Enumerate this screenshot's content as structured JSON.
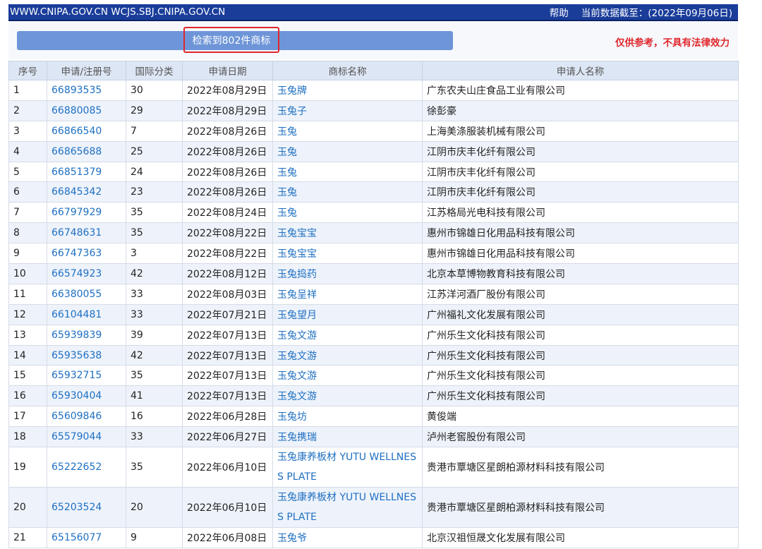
{
  "header": {
    "site": "WWW.CNIPA.GOV.CN WCJS.SBJ.CNIPA.GOV.CN",
    "help": "帮助",
    "data_cutoff": "当前数据截至：(2022年09月06日)"
  },
  "search": {
    "result_text": "检索到802件商标",
    "disclaimer": "仅供参考，不具有法律效力"
  },
  "table": {
    "columns": [
      "序号",
      "申请/注册号",
      "国际分类",
      "申请日期",
      "商标名称",
      "申请人名称"
    ],
    "rows": [
      {
        "no": "1",
        "reg": "66893535",
        "cls": "30",
        "date": "2022年08月29日",
        "name": "玉兔牌",
        "applicant": "广东农夫山庄食品工业有限公司"
      },
      {
        "no": "2",
        "reg": "66880085",
        "cls": "29",
        "date": "2022年08月29日",
        "name": "玉兔子",
        "applicant": "徐彭豪"
      },
      {
        "no": "3",
        "reg": "66866540",
        "cls": "7",
        "date": "2022年08月26日",
        "name": "玉兔",
        "applicant": "上海美涤服装机械有限公司"
      },
      {
        "no": "4",
        "reg": "66865688",
        "cls": "25",
        "date": "2022年08月26日",
        "name": "玉兔",
        "applicant": "江阴市庆丰化纤有限公司"
      },
      {
        "no": "5",
        "reg": "66851379",
        "cls": "24",
        "date": "2022年08月26日",
        "name": "玉兔",
        "applicant": "江阴市庆丰化纤有限公司"
      },
      {
        "no": "6",
        "reg": "66845342",
        "cls": "23",
        "date": "2022年08月26日",
        "name": "玉兔",
        "applicant": "江阴市庆丰化纤有限公司"
      },
      {
        "no": "7",
        "reg": "66797929",
        "cls": "35",
        "date": "2022年08月24日",
        "name": "玉兔",
        "applicant": "江苏格局光电科技有限公司"
      },
      {
        "no": "8",
        "reg": "66748631",
        "cls": "35",
        "date": "2022年08月22日",
        "name": "玉兔宝宝",
        "applicant": "惠州市锦雄日化用品科技有限公司"
      },
      {
        "no": "9",
        "reg": "66747363",
        "cls": "3",
        "date": "2022年08月22日",
        "name": "玉兔宝宝",
        "applicant": "惠州市锦雄日化用品科技有限公司"
      },
      {
        "no": "10",
        "reg": "66574923",
        "cls": "42",
        "date": "2022年08月12日",
        "name": "玉兔捣药",
        "applicant": "北京本草博物教育科技有限公司"
      },
      {
        "no": "11",
        "reg": "66380055",
        "cls": "33",
        "date": "2022年08月03日",
        "name": "玉兔呈祥",
        "applicant": "江苏洋河酒厂股份有限公司"
      },
      {
        "no": "12",
        "reg": "66104481",
        "cls": "33",
        "date": "2022年07月21日",
        "name": "玉兔望月",
        "applicant": "广州福礼文化发展有限公司"
      },
      {
        "no": "13",
        "reg": "65939839",
        "cls": "39",
        "date": "2022年07月13日",
        "name": "玉兔文游",
        "applicant": "广州乐生文化科技有限公司"
      },
      {
        "no": "14",
        "reg": "65935638",
        "cls": "42",
        "date": "2022年07月13日",
        "name": "玉兔文游",
        "applicant": "广州乐生文化科技有限公司"
      },
      {
        "no": "15",
        "reg": "65932715",
        "cls": "35",
        "date": "2022年07月13日",
        "name": "玉兔文游",
        "applicant": "广州乐生文化科技有限公司"
      },
      {
        "no": "16",
        "reg": "65930404",
        "cls": "41",
        "date": "2022年07月13日",
        "name": "玉兔文游",
        "applicant": "广州乐生文化科技有限公司"
      },
      {
        "no": "17",
        "reg": "65609846",
        "cls": "16",
        "date": "2022年06月28日",
        "name": "玉兔坊",
        "applicant": "黄俊端"
      },
      {
        "no": "18",
        "reg": "65579044",
        "cls": "33",
        "date": "2022年06月27日",
        "name": "玉兔携瑞",
        "applicant": "泸州老窖股份有限公司"
      },
      {
        "no": "19",
        "reg": "65222652",
        "cls": "35",
        "date": "2022年06月10日",
        "name": "玉兔康养板材 YUTU WELLNESS PLATE",
        "applicant": "贵港市覃塘区星朗柏源材料科技有限公司",
        "tall": true
      },
      {
        "no": "20",
        "reg": "65203524",
        "cls": "20",
        "date": "2022年06月10日",
        "name": "玉兔康养板材 YUTU WELLNESS PLATE",
        "applicant": "贵港市覃塘区星朗柏源材料科技有限公司",
        "tall": true
      },
      {
        "no": "21",
        "reg": "65156077",
        "cls": "9",
        "date": "2022年06月08日",
        "name": "玉兔爷",
        "applicant": "北京汉祖恒晟文化发展有限公司"
      }
    ]
  }
}
